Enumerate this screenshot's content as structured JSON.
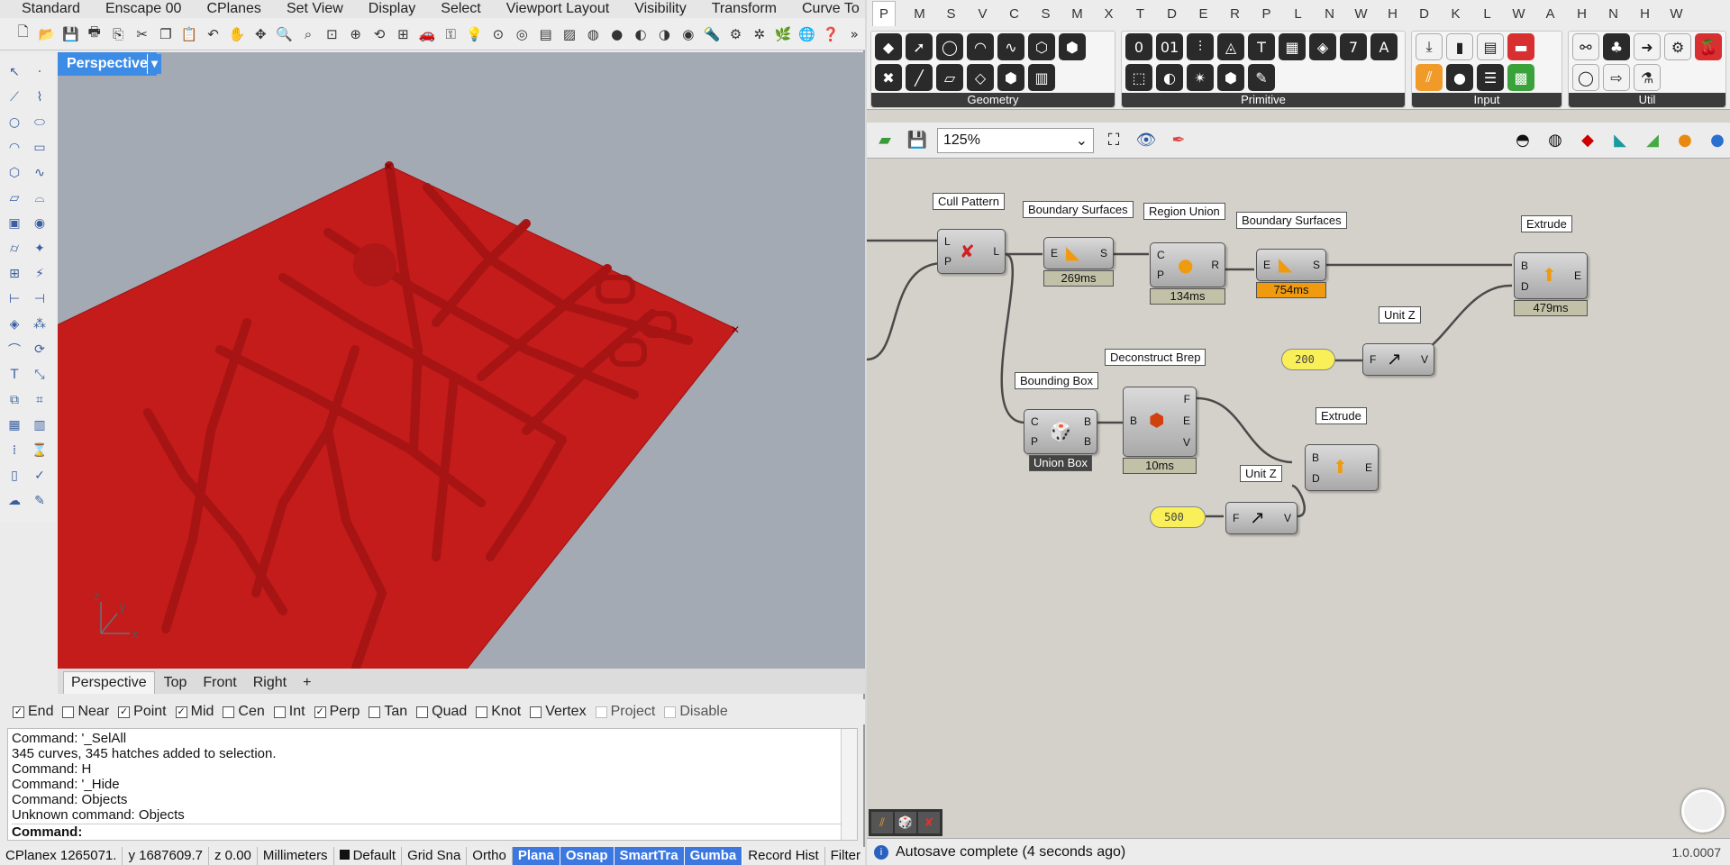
{
  "rhino": {
    "tabs": [
      "Standard",
      "Enscape 00",
      "CPlanes",
      "Set View",
      "Display",
      "Select",
      "Viewport Layout",
      "Visibility",
      "Transform",
      "Curve To"
    ],
    "viewport": {
      "name": "Perspective"
    },
    "view_tabs": [
      "Perspective",
      "Top",
      "Front",
      "Right"
    ],
    "osnaps": [
      {
        "label": "End",
        "checked": true
      },
      {
        "label": "Near",
        "checked": false
      },
      {
        "label": "Point",
        "checked": true
      },
      {
        "label": "Mid",
        "checked": true
      },
      {
        "label": "Cen",
        "checked": false
      },
      {
        "label": "Int",
        "checked": false
      },
      {
        "label": "Perp",
        "checked": true
      },
      {
        "label": "Tan",
        "checked": false
      },
      {
        "label": "Quad",
        "checked": false
      },
      {
        "label": "Knot",
        "checked": false
      },
      {
        "label": "Vertex",
        "checked": false
      },
      {
        "label": "Project",
        "checked": false,
        "disabled": true
      },
      {
        "label": "Disable",
        "checked": false,
        "disabled": true
      }
    ],
    "command_history": [
      "Command: '_SelAll",
      "345 curves, 345 hatches added to selection.",
      "Command: H",
      "Command: '_Hide",
      "Command: Objects",
      "Unknown command: Objects"
    ],
    "command_prompt": "Command:",
    "status": {
      "cplane_x": "CPlanex 1265071.",
      "cplane_y": "y 1687609.7",
      "z": "z 0.00",
      "units": "Millimeters",
      "layer": "Default",
      "toggles": [
        "Grid Sna",
        "Ortho",
        "Plana",
        "Osnap",
        "SmartTra",
        "Gumba",
        "Record Hist",
        "Filter"
      ]
    },
    "axes": {
      "x": "x",
      "y": "y",
      "z": "z"
    },
    "surface_color": "#c41b1b",
    "viewport_bg": "#a3aab3"
  },
  "gh": {
    "tabs": [
      "P",
      "M",
      "S",
      "V",
      "C",
      "S",
      "M",
      "X",
      "T",
      "D",
      "E",
      "R",
      "P",
      "L",
      "N",
      "W",
      "H",
      "D",
      "K",
      "L",
      "W",
      "A",
      "H",
      "N",
      "H",
      "W"
    ],
    "groups": [
      "Geometry",
      "Primitive",
      "Input",
      "Util"
    ],
    "zoom": "125%",
    "components": {
      "cull_pattern": {
        "title": "Cull Pattern",
        "in": [
          "L",
          "P"
        ],
        "out": [
          "L"
        ]
      },
      "boundary1": {
        "title": "Boundary Surfaces",
        "in": [
          "E"
        ],
        "out": [
          "S"
        ],
        "time": "269ms"
      },
      "region_union": {
        "title": "Region Union",
        "in": [
          "C",
          "P"
        ],
        "out": [
          "R"
        ],
        "time": "134ms"
      },
      "boundary2": {
        "title": "Boundary Surfaces",
        "in": [
          "E"
        ],
        "out": [
          "S"
        ],
        "time": "754ms"
      },
      "extrude1": {
        "title": "Extrude",
        "in": [
          "B",
          "D"
        ],
        "out": [
          "E"
        ],
        "time": "479ms"
      },
      "unitz1": {
        "title": "Unit Z",
        "in": [
          "F"
        ],
        "out": [
          "V"
        ]
      },
      "slider1": {
        "value": "200"
      },
      "bounding_box": {
        "title": "Bounding Box",
        "in": [
          "C",
          "P"
        ],
        "out": [
          "B",
          "B"
        ],
        "label": "Union Box"
      },
      "deconstruct": {
        "title": "Deconstruct Brep",
        "in": [
          "B"
        ],
        "out": [
          "F",
          "E",
          "V"
        ],
        "time": "10ms"
      },
      "extrude2": {
        "title": "Extrude",
        "in": [
          "B",
          "D"
        ],
        "out": [
          "E"
        ]
      },
      "unitz2": {
        "title": "Unit Z",
        "in": [
          "F"
        ],
        "out": [
          "V"
        ]
      },
      "slider2": {
        "value": "500"
      }
    },
    "status_message": "Autosave complete (4 seconds ago)",
    "version": "1.0.0007"
  }
}
